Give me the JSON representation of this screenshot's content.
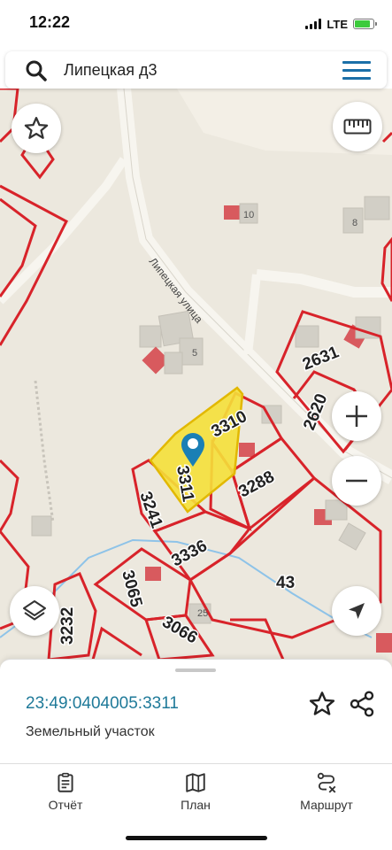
{
  "status_bar": {
    "time": "12:22",
    "network": "LTE",
    "battery_level": 0.75
  },
  "search": {
    "query": "Липецкая д3"
  },
  "map": {
    "street_label": "Липецкая улица",
    "selected_parcel_label": "3311",
    "parcel_labels": [
      "3310",
      "3288",
      "3241",
      "3336",
      "2631",
      "2620",
      "3065",
      "3066",
      "3232",
      "43"
    ],
    "building_labels": [
      "10",
      "8",
      "5",
      "25"
    ],
    "colors": {
      "parcel_border": "#d8232a",
      "selected_fill": "#f5e03a",
      "building": "#d2cfc6",
      "road": "#f7f5ef",
      "background": "#ece8de",
      "pin": "#1a7fb5"
    }
  },
  "sheet": {
    "parcel_id": "23:49:0404005:3311",
    "parcel_type": "Земельный участок"
  },
  "tabs": [
    {
      "label": "Отчёт",
      "icon": "report-icon"
    },
    {
      "label": "План",
      "icon": "map-book-icon"
    },
    {
      "label": "Маршрут",
      "icon": "route-icon"
    }
  ]
}
